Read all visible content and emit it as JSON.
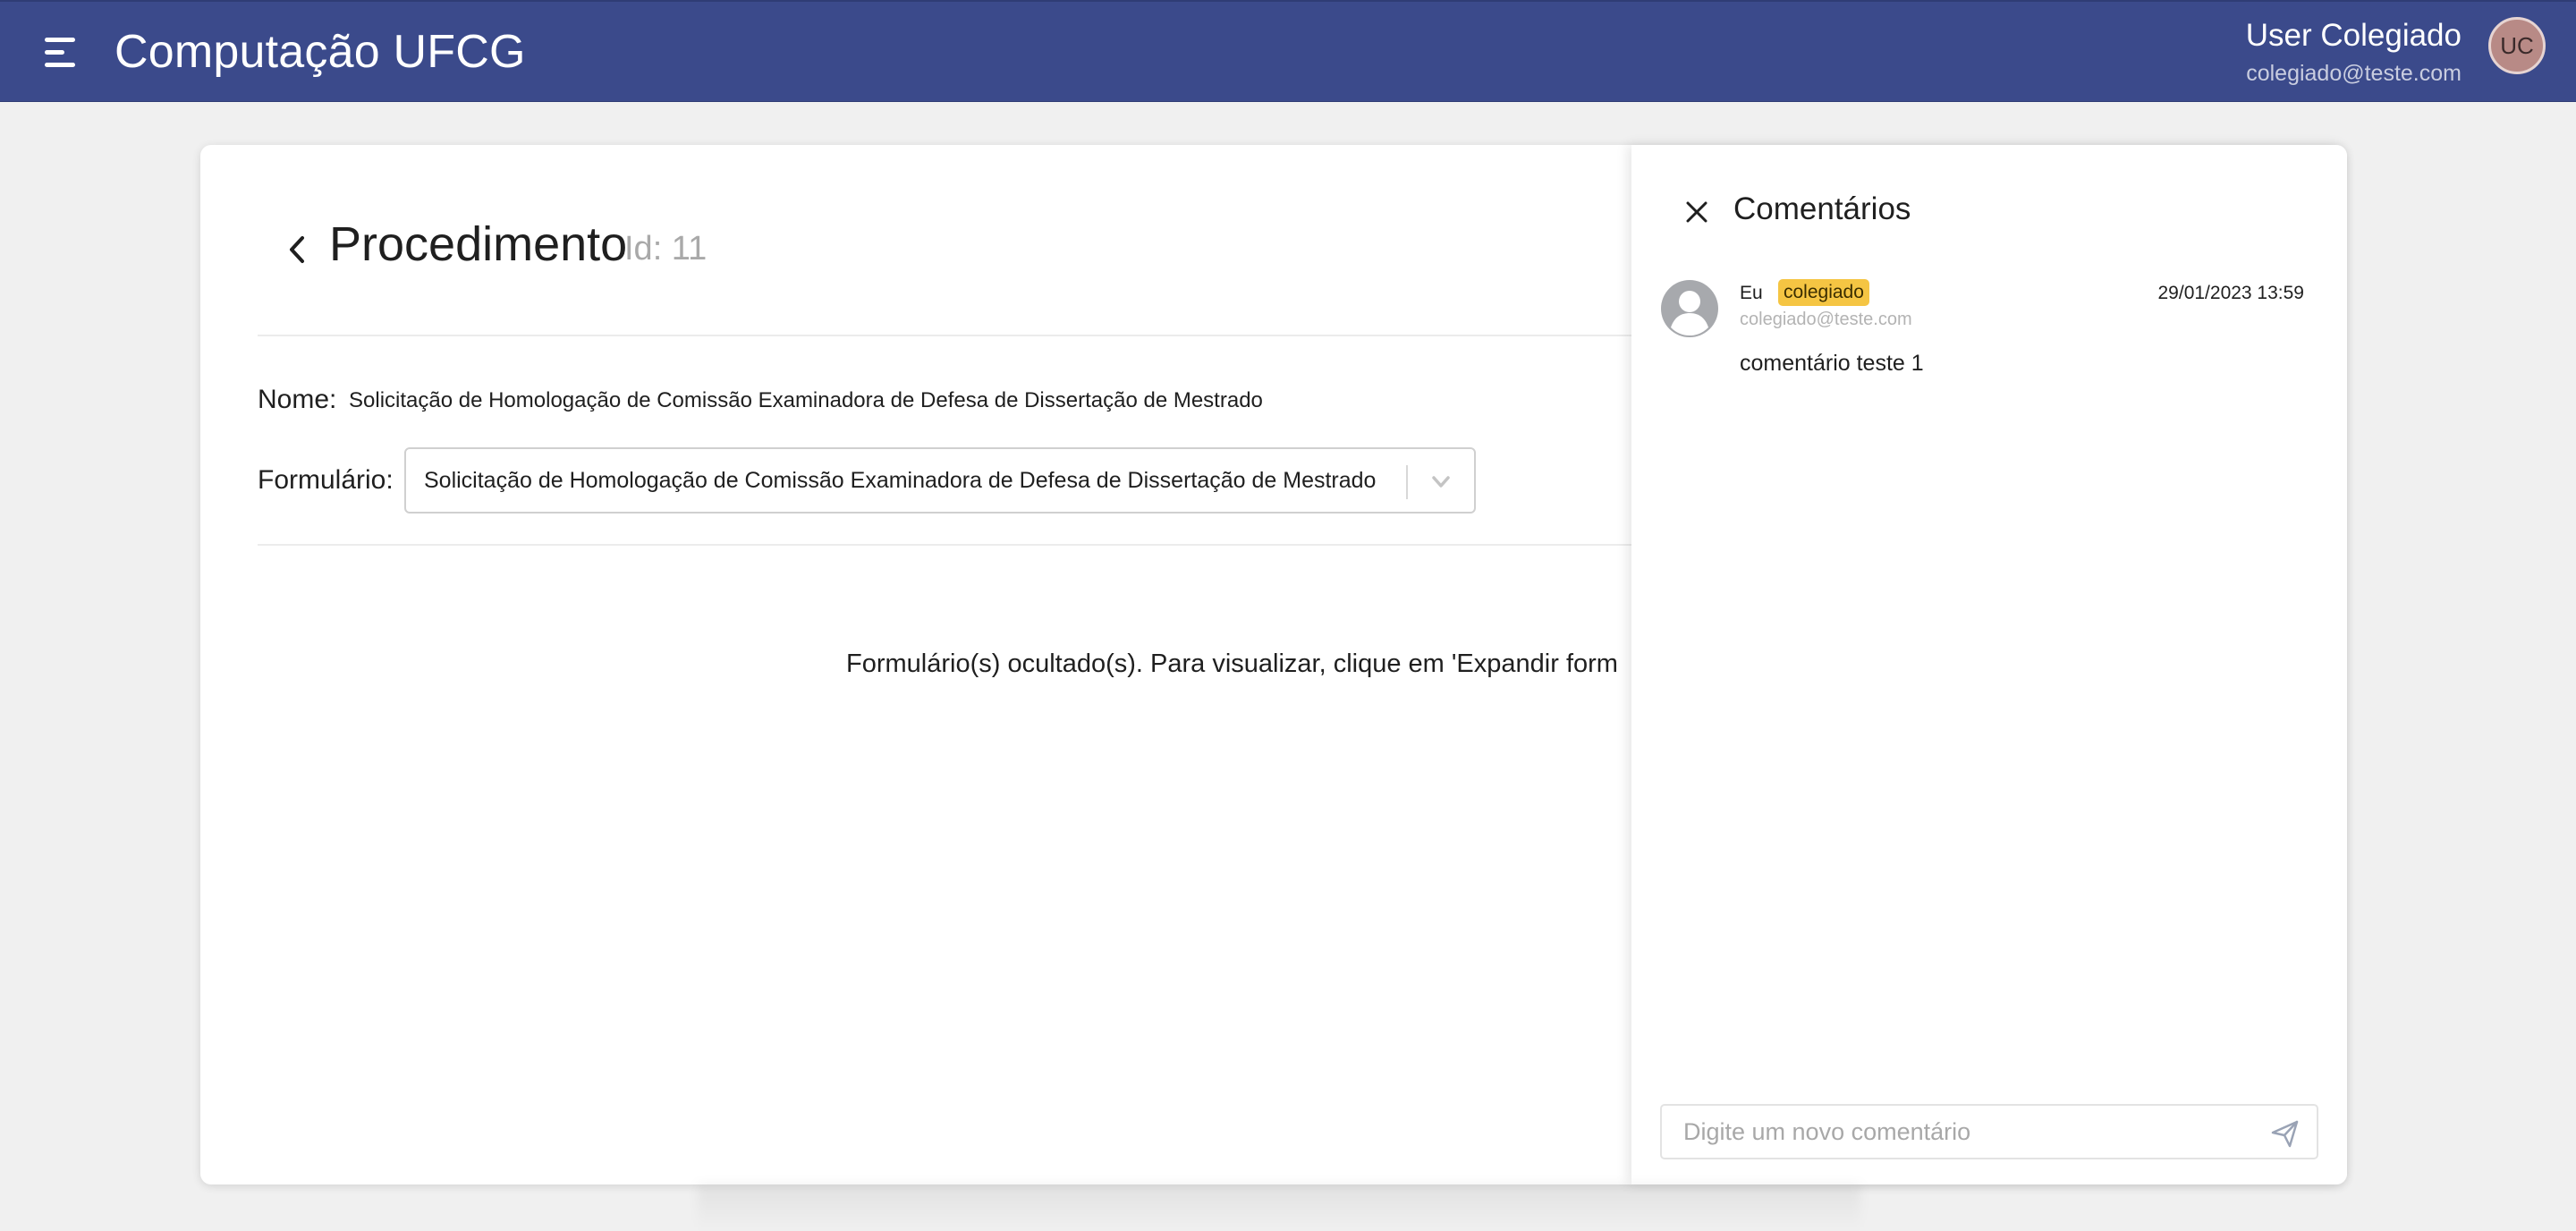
{
  "header": {
    "app_title": "Computação UFCG",
    "user_name": "User Colegiado",
    "user_email": "colegiado@teste.com",
    "avatar_initials": "UC",
    "bar_color": "#3b4a8b"
  },
  "page": {
    "title": "Procedimento",
    "id_label": "Id: 11",
    "nome_label": "Nome:",
    "nome_value": "Solicitação de Homologação de Comissão Examinadora de Defesa de Dissertação de Mestrado",
    "formulario_label": "Formulário:",
    "formulario_selected": "Solicitação de Homologação de Comissão Examinadora de Defesa de Dissertação de Mestrado",
    "hidden_message": "Formulário(s) ocultado(s). Para visualizar, clique em 'Expandir form"
  },
  "comments": {
    "title": "Comentários",
    "items": [
      {
        "author": "Eu",
        "role_badge": "colegiado",
        "email": "colegiado@teste.com",
        "timestamp": "29/01/2023 13:59",
        "text": "comentário teste 1"
      }
    ],
    "input_placeholder": "Digite um novo comentário",
    "badge_color": "#f5c543"
  },
  "icons": {
    "menu": "menu-icon",
    "back": "chevron-left-icon",
    "dropdown": "chevron-down-icon",
    "close": "close-icon",
    "user_avatar": "user-avatar-icon",
    "send": "send-icon"
  }
}
